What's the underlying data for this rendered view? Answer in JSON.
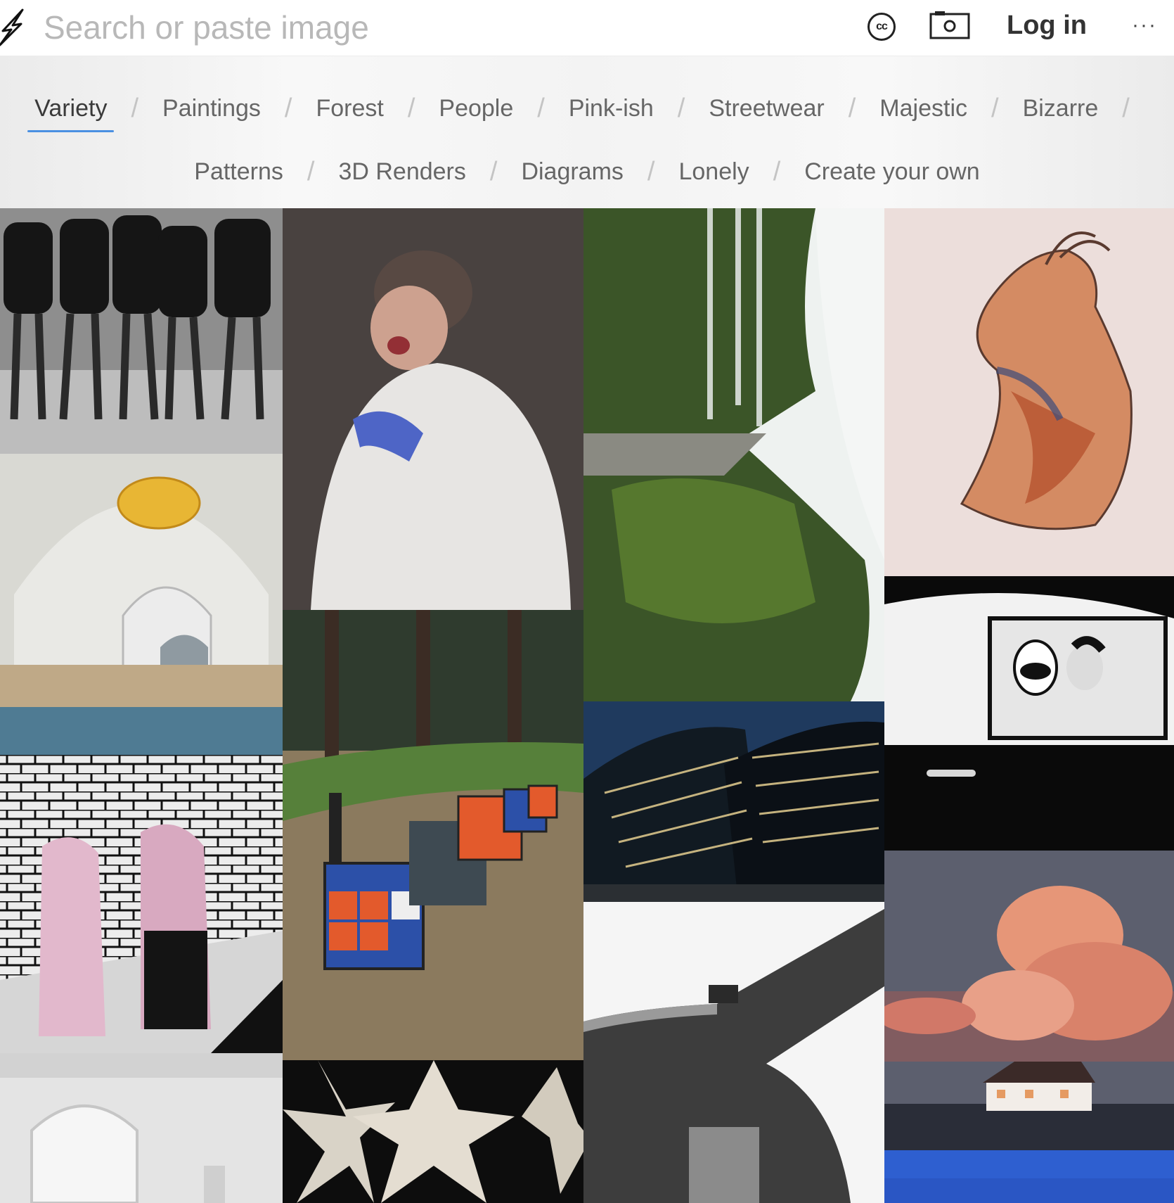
{
  "header": {
    "logo_icon": "lightning-bolt-icon",
    "search_placeholder": "Search or paste image",
    "license_icon": "creative-commons-icon",
    "license_label": "cc",
    "camera_icon": "camera-icon",
    "login_label": "Log in",
    "more_label": "···",
    "more_icon": "more-options-icon"
  },
  "categories": {
    "row1": [
      "Variety",
      "Paintings",
      "Forest",
      "People",
      "Pink-ish",
      "Streetwear",
      "Majestic",
      "Bizarre"
    ],
    "row2": [
      "Patterns",
      "3D Renders",
      "Diagrams",
      "Lonely",
      "Create your own"
    ],
    "separator": "/",
    "active": "Variety",
    "accent_color": "#4a90e2"
  },
  "gallery": {
    "tiles": [
      {
        "name": "women-black-dresses-photo",
        "palette": [
          "#2a2a2a",
          "#9a9a9a"
        ]
      },
      {
        "name": "domed-pool-hall-photo",
        "palette": [
          "#d8d8d2",
          "#4f6f86"
        ]
      },
      {
        "name": "fur-coats-mural-photo",
        "palette": [
          "#e8e8e8",
          "#e2b8cc"
        ]
      },
      {
        "name": "arched-white-room-photo",
        "palette": [
          "#e6e6e6",
          "#bdbdbd"
        ]
      },
      {
        "name": "plastic-wrap-face-photo",
        "palette": [
          "#3a3230",
          "#e4e2e0"
        ]
      },
      {
        "name": "rubik-cube-benches-photo",
        "palette": [
          "#2f3b2e",
          "#8b7a5e"
        ]
      },
      {
        "name": "geometric-stars-pattern",
        "palette": [
          "#0d0d0d",
          "#d9d3c7"
        ]
      },
      {
        "name": "mossy-waterfall-photo",
        "palette": [
          "#2e4a1e",
          "#eef2f0"
        ]
      },
      {
        "name": "curved-skyscrapers-photo",
        "palette": [
          "#1f3a5e",
          "#101418"
        ]
      },
      {
        "name": "concrete-tower-photo",
        "palette": [
          "#f4f4f4",
          "#3e3e3e"
        ]
      },
      {
        "name": "hand-watercolor-sketch",
        "palette": [
          "#ecdedb",
          "#c9825c"
        ]
      },
      {
        "name": "couple-in-car-photo",
        "palette": [
          "#0a0a0a",
          "#f2f2f2"
        ]
      },
      {
        "name": "pink-cloud-house-photo",
        "palette": [
          "#5c5f6e",
          "#e69678"
        ]
      },
      {
        "name": "blue-sea-photo",
        "palette": [
          "#2e5fd0",
          "#2a56c4"
        ]
      }
    ]
  }
}
